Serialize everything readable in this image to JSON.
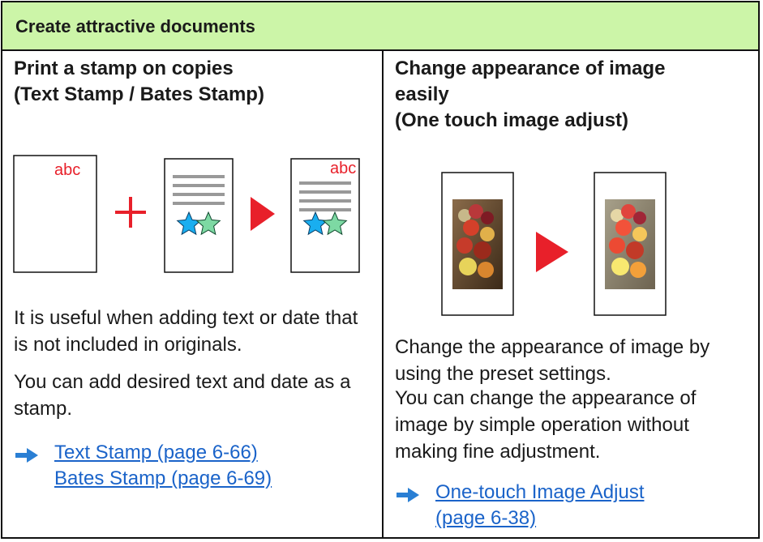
{
  "header": {
    "title": "Create attractive documents"
  },
  "left": {
    "title_line1": "Print a stamp on copies",
    "title_line2": "(Text Stamp / Bates Stamp)",
    "stamp_text": "abc",
    "paragraph1": "It is useful when adding text or date that is not included in originals.",
    "paragraph2": "You can add desired text and date as a stamp.",
    "links": [
      "Text Stamp (page 6-66)",
      "Bates Stamp (page 6-69)"
    ]
  },
  "right": {
    "title_line1": "Change appearance of image",
    "title_line2": "easily",
    "title_line3": "(One touch image adjust)",
    "paragraph1": "Change the appearance of image by using the preset settings.",
    "paragraph2": "You can change the appearance of image by simple operation without making fine adjustment.",
    "links": [
      "One-touch Image Adjust ",
      "(page 6-38)"
    ]
  },
  "colors": {
    "header_bg": "#ccf5a8",
    "link": "#1a63c9",
    "accent_red": "#e8202a",
    "arrow_blue": "#2a7fd4",
    "star_blue": "#19aef0",
    "star_green": "#7dd9a3"
  }
}
